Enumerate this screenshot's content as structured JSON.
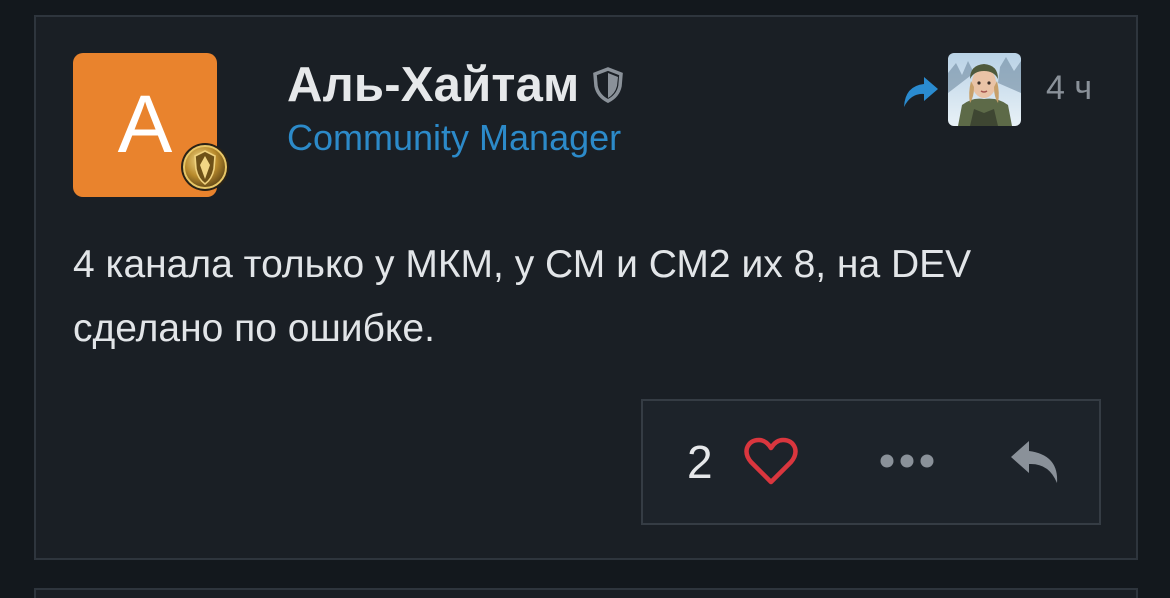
{
  "post": {
    "author": {
      "initial": "А",
      "name": "Аль-Хайтам",
      "role": "Community Manager",
      "avatar_color": "#e9832d",
      "badge_icon": "gold-shield-rank-badge",
      "staff_icon": "shield-icon"
    },
    "reply_target": {
      "share_icon": "share-arrow-icon",
      "avatar_description_icon": "recipient-avatar"
    },
    "time": "4 ч",
    "body_lines": [
      "4 канала только у МКМ, у СМ и СМ2 их 8, на DEV",
      "сделано по ошибке."
    ],
    "actions": {
      "like_count": "2",
      "like_icon": "heart-outline-icon",
      "more_icon": "ellipsis-icon",
      "reply_icon": "reply-arrow-icon"
    },
    "colors": {
      "accent": "#2c8ac9",
      "heart": "#d9363e",
      "background": "#13181d",
      "card": "#1a1f25"
    }
  }
}
